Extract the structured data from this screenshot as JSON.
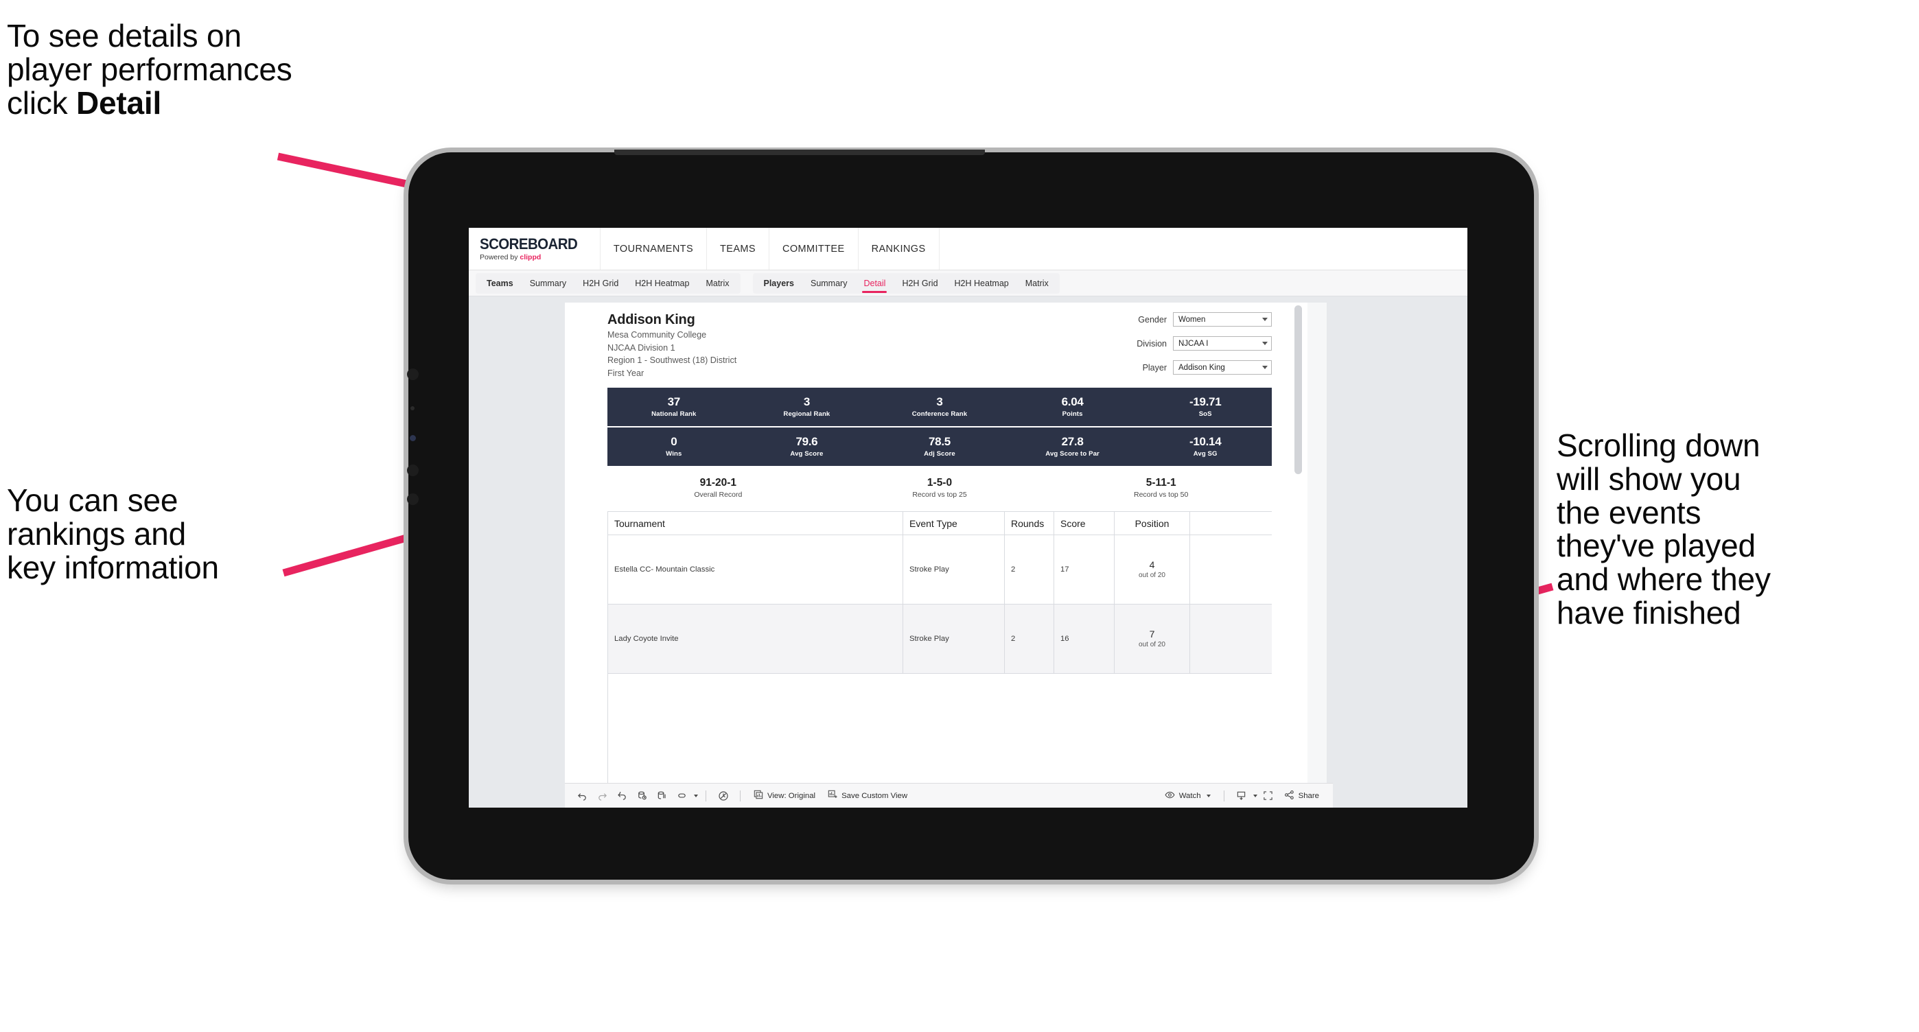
{
  "annotations": {
    "top_left": "To see details on\nplayer performances\nclick ",
    "top_left_bold": "Detail",
    "left": "You can see\nrankings and\nkey information",
    "right": "Scrolling down\nwill show you\nthe events\nthey've played\nand where they\nhave finished"
  },
  "colors": {
    "accent_pink": "#E8245F",
    "stat_navy": "#2C3347",
    "arrow_pink": "#E8245F"
  },
  "browser": {
    "brand": {
      "name": "SCOREBOARD",
      "powered_prefix": "Powered by ",
      "powered_brand": "clippd"
    },
    "top_nav": [
      "TOURNAMENTS",
      "TEAMS",
      "COMMITTEE",
      "RANKINGS"
    ],
    "sub_nav": {
      "teams_group": {
        "title": "Teams",
        "items": [
          "Summary",
          "H2H Grid",
          "H2H Heatmap",
          "Matrix"
        ]
      },
      "players_group": {
        "title": "Players",
        "items": [
          "Summary",
          "Detail",
          "H2H Grid",
          "H2H Heatmap",
          "Matrix"
        ],
        "active": "Detail"
      }
    }
  },
  "player": {
    "name": "Addison King",
    "school": "Mesa Community College",
    "division": "NJCAA Division 1",
    "region": "Region 1 - Southwest (18) District",
    "year": "First Year"
  },
  "filters": [
    {
      "label": "Gender",
      "value": "Women"
    },
    {
      "label": "Division",
      "value": "NJCAA I"
    },
    {
      "label": "Player",
      "value": "Addison King"
    }
  ],
  "stats_row_1": [
    {
      "value": "37",
      "label": "National Rank"
    },
    {
      "value": "3",
      "label": "Regional Rank"
    },
    {
      "value": "3",
      "label": "Conference Rank"
    },
    {
      "value": "6.04",
      "label": "Points"
    },
    {
      "value": "-19.71",
      "label": "SoS"
    }
  ],
  "stats_row_2": [
    {
      "value": "0",
      "label": "Wins"
    },
    {
      "value": "79.6",
      "label": "Avg Score"
    },
    {
      "value": "78.5",
      "label": "Adj Score"
    },
    {
      "value": "27.8",
      "label": "Avg Score to Par"
    },
    {
      "value": "-10.14",
      "label": "Avg SG"
    }
  ],
  "records": [
    {
      "value": "91-20-1",
      "label": "Overall Record"
    },
    {
      "value": "1-5-0",
      "label": "Record vs top 25"
    },
    {
      "value": "5-11-1",
      "label": "Record vs top 50"
    }
  ],
  "events_table": {
    "columns": [
      "Tournament",
      "Event Type",
      "Rounds",
      "Score",
      "Position"
    ],
    "rows": [
      {
        "tournament": "Estella CC- Mountain Classic",
        "event_type": "Stroke Play",
        "rounds": "2",
        "score": "17",
        "position": "4",
        "position_of": "out of 20"
      },
      {
        "tournament": "Lady Coyote Invite",
        "event_type": "Stroke Play",
        "rounds": "2",
        "score": "16",
        "position": "7",
        "position_of": "out of 20"
      }
    ]
  },
  "toolbar": {
    "view_label": "View: Original",
    "save_custom_view": "Save Custom View",
    "watch": "Watch",
    "share": "Share",
    "icons": [
      "undo-icon",
      "redo-icon",
      "revert-icon",
      "refresh-icon",
      "pause-icon",
      "data-source-icon",
      "history-icon",
      "view-original-icon",
      "save-custom-view-icon",
      "eye-icon",
      "download-icon",
      "fullscreen-icon",
      "share-icon"
    ]
  }
}
